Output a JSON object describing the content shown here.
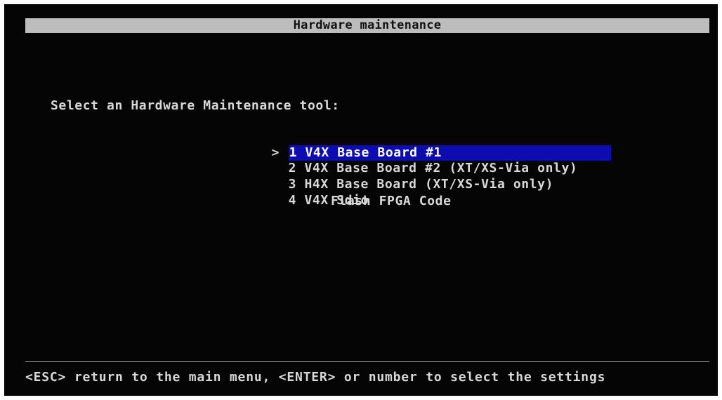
{
  "screen": {
    "title": "Hardware maintenance",
    "prompt": "Select an Hardware Maintenance tool:",
    "cursor_glyph": ">",
    "menu": {
      "items": [
        {
          "label": "1 V4X Base Board #1",
          "selected": true
        },
        {
          "label": "2 V4X Base Board #2 (XT/XS-Via only)",
          "selected": false
        },
        {
          "label": "3 H4X Base Board (XT/XS-Via only)",
          "selected": false
        },
        {
          "label": "4 V4X Sdio",
          "selected": false
        }
      ],
      "extra_label": "Flash FPGA Code"
    },
    "footer": "<ESC> return to the main menu, <ENTER> or number to select the settings"
  },
  "colors": {
    "background": "#050505",
    "title_bar": "#bdbdbd",
    "text": "#d8d8d8",
    "selection": "#0c0cb0"
  }
}
